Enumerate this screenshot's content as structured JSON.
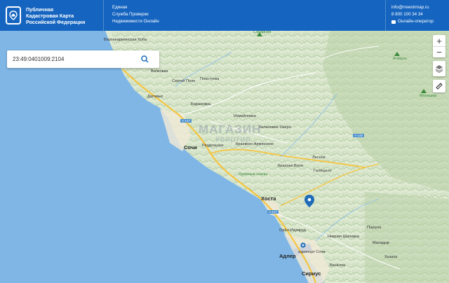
{
  "header": {
    "title_line1": "Публичная",
    "title_line2": "Кадастровая Карта",
    "title_line3": "Российской Федерации",
    "service_line1": "Единая",
    "service_line2": "Служба Проверки",
    "service_line3": "Недвижимости Онлайн",
    "email": "info@rreestrmap.ru",
    "phone": "8 800 100 34 34",
    "chat_label": "Онлайн-оператор"
  },
  "search": {
    "value": "23:49:0401009:2104"
  },
  "controls": {
    "zoom_in": "+",
    "zoom_out": "−"
  },
  "watermark": {
    "line1": "МАГАЗИН",
    "line2": "квартир"
  },
  "map": {
    "places": [
      "Верхнеармянская Хоба",
      "Волковка",
      "Сергей Поле",
      "Пластунка",
      "Дагомыс",
      "Барановка",
      "Измайловка",
      "Калиновое Озеро",
      "Сочи",
      "Раздольное",
      "Краевско-Армянское",
      "Лесное",
      "Красная Воля",
      "Галицыно",
      "Хоста",
      "Орёл-Изумруд",
      "Нижняя Шиловка",
      "Пщоуха",
      "Махадыр",
      "Хышха",
      "Адлер",
      "аэропорт Сочи",
      "Весёлое",
      "Сириус",
      "Сахарная",
      "Ачишхо",
      "Монашка",
      "Орлиные скалы"
    ],
    "roads": [
      "А-147",
      "А-148"
    ],
    "colors": {
      "sea": "#7fb6e6",
      "land": "#dde9d1",
      "terrain": "#b8cfa6",
      "header": "#1565c0",
      "marker": "#1e6bb8"
    }
  }
}
